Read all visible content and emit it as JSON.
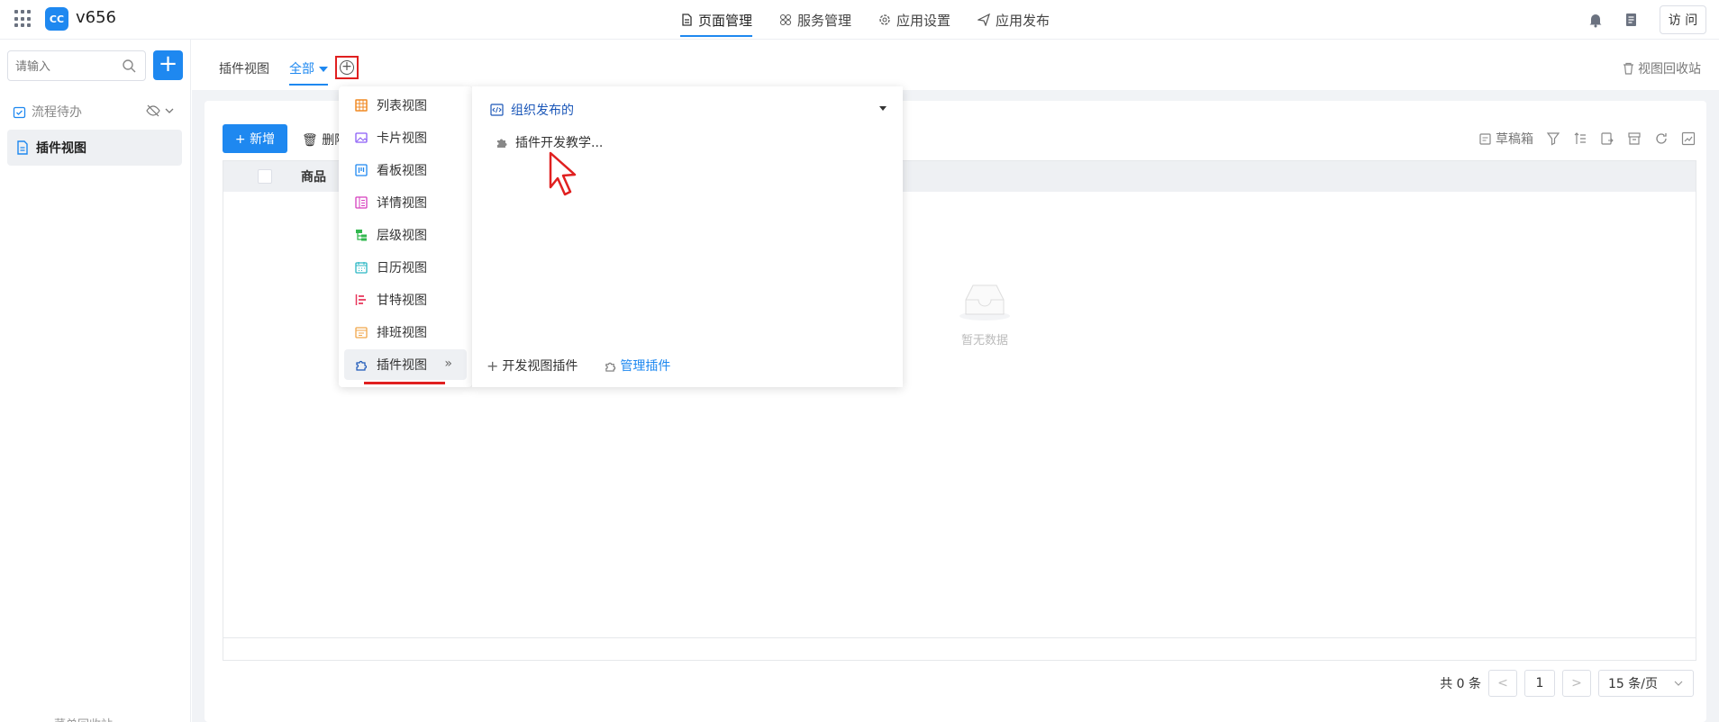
{
  "topbar": {
    "app_name": "v656",
    "logo_text": "CC",
    "nav": [
      {
        "label": "页面管理",
        "icon": "document-icon",
        "active": true
      },
      {
        "label": "服务管理",
        "icon": "grid-cluster-icon",
        "active": false
      },
      {
        "label": "应用设置",
        "icon": "gear-icon",
        "active": false
      },
      {
        "label": "应用发布",
        "icon": "send-icon",
        "active": false
      }
    ],
    "visit_label": "访 问"
  },
  "sidebar": {
    "search_placeholder": "请输入",
    "group_label": "流程待办",
    "active_item": "插件视图",
    "bottom_label": "菜单回收站"
  },
  "viewbar": {
    "tab_plugin": "插件视图",
    "tab_all": "全部",
    "recycle_label": "视图回收站"
  },
  "content": {
    "new_label": "+ 新增",
    "delete_label": "删除",
    "draft_label": "草稿箱",
    "column_header": "商品",
    "empty_text": "暂无数据",
    "pager": {
      "total_label": "共 0 条",
      "current_page": "1",
      "page_size": "15 条/页"
    }
  },
  "view_menu": {
    "items": [
      {
        "label": "列表视图",
        "icon": "table-icon",
        "color": "#f08a24"
      },
      {
        "label": "卡片视图",
        "icon": "image-card-icon",
        "color": "#8a5cf6"
      },
      {
        "label": "看板视图",
        "icon": "kanban-icon",
        "color": "#1e88f0"
      },
      {
        "label": "详情视图",
        "icon": "detail-icon",
        "color": "#d63fbe"
      },
      {
        "label": "层级视图",
        "icon": "hierarchy-icon",
        "color": "#32b84f"
      },
      {
        "label": "日历视图",
        "icon": "calendar-icon",
        "color": "#2bb7c4"
      },
      {
        "label": "甘特视图",
        "icon": "gantt-icon",
        "color": "#e8355a"
      },
      {
        "label": "排班视图",
        "icon": "schedule-icon",
        "color": "#f0a64a"
      },
      {
        "label": "插件视图",
        "icon": "puzzle-icon",
        "color": "#1a56b8"
      }
    ],
    "org_header": "组织发布的",
    "plugin_entry": "插件开发教学...",
    "dev_plugin_label": "开发视图插件",
    "manage_plugin_label": "管理插件"
  }
}
